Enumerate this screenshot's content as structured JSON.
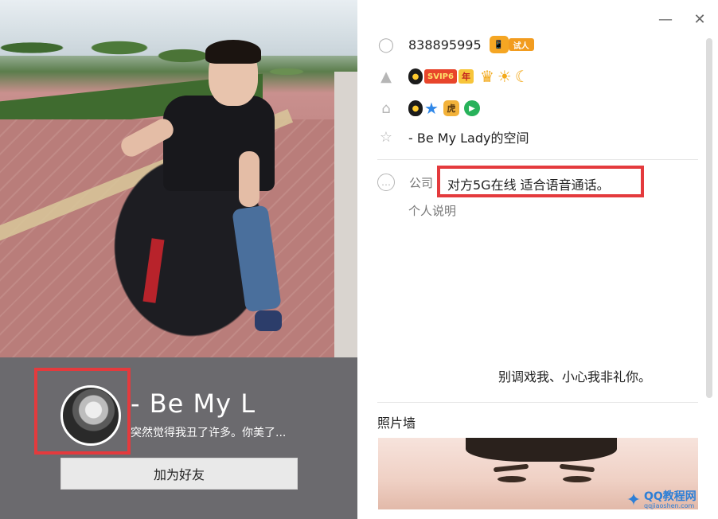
{
  "profile": {
    "nickname": "-     Be My L",
    "signature": "突然觉得我丑了许多。你美了...",
    "add_friend_label": "加为好友"
  },
  "window": {
    "minimize_glyph": "—",
    "close_glyph": "✕"
  },
  "info": {
    "qq_number": "838895995",
    "phone_badge": "📱",
    "shiren_badge": "试人",
    "svip_label": "SVIP6",
    "year_label": "年",
    "space_name": "-     Be  My  Lady的空间",
    "company_label": "公司",
    "company_value": "对方5G在线   适合语音通话。",
    "personal_label": "个人说明",
    "personal_text": "别调戏我、小心我非礼你。",
    "photo_wall_title": "照片墙"
  },
  "icons": {
    "qq_icon": "◯",
    "level_icon": "▲",
    "home_icon": "⌂",
    "star_icon": "☆",
    "more_icon": "…"
  },
  "watermark": {
    "title": "QQ教程网",
    "sub": "qqjiaoshen.com"
  },
  "colors": {
    "highlight": "#e43a3d",
    "profile_bar": "#6b6a6e"
  }
}
